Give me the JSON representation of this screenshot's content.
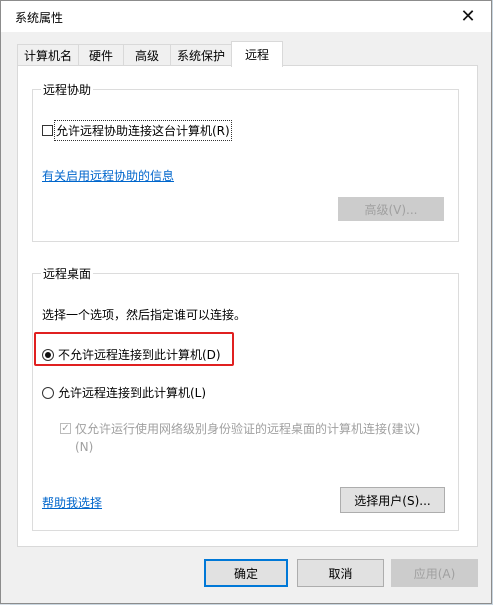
{
  "window": {
    "title": "系统属性",
    "close_glyph": "✕"
  },
  "tabs": [
    {
      "label": "计算机名",
      "active": false
    },
    {
      "label": "硬件",
      "active": false
    },
    {
      "label": "高级",
      "active": false
    },
    {
      "label": "系统保护",
      "active": false
    },
    {
      "label": "远程",
      "active": true
    }
  ],
  "remote_assistance": {
    "group_title": "远程协助",
    "allow_checkbox_label": "允许远程协助连接这台计算机(R)",
    "allow_checked": false,
    "info_link": "有关启用远程协助的信息",
    "advanced_button": "高级(V)..."
  },
  "remote_desktop": {
    "group_title": "远程桌面",
    "instruction": "选择一个选项，然后指定谁可以连接。",
    "option_deny": "不允许远程连接到此计算机(D)",
    "option_allow": "允许远程连接到此计算机(L)",
    "selected": "deny",
    "nla_checkbox_label_line1": "仅允许运行使用网络级别身份验证的远程桌面的计算机连接(建议)",
    "nla_checkbox_label_line2": "(N)",
    "nla_checked": true,
    "help_link": "帮助我选择",
    "select_users_button": "选择用户(S)..."
  },
  "footer": {
    "ok_button": "确定",
    "cancel_button": "取消",
    "apply_button": "应用(A)"
  },
  "colors": {
    "highlight_border": "#e02020",
    "link": "#0066cc",
    "primary_button_border": "#0078d7"
  }
}
